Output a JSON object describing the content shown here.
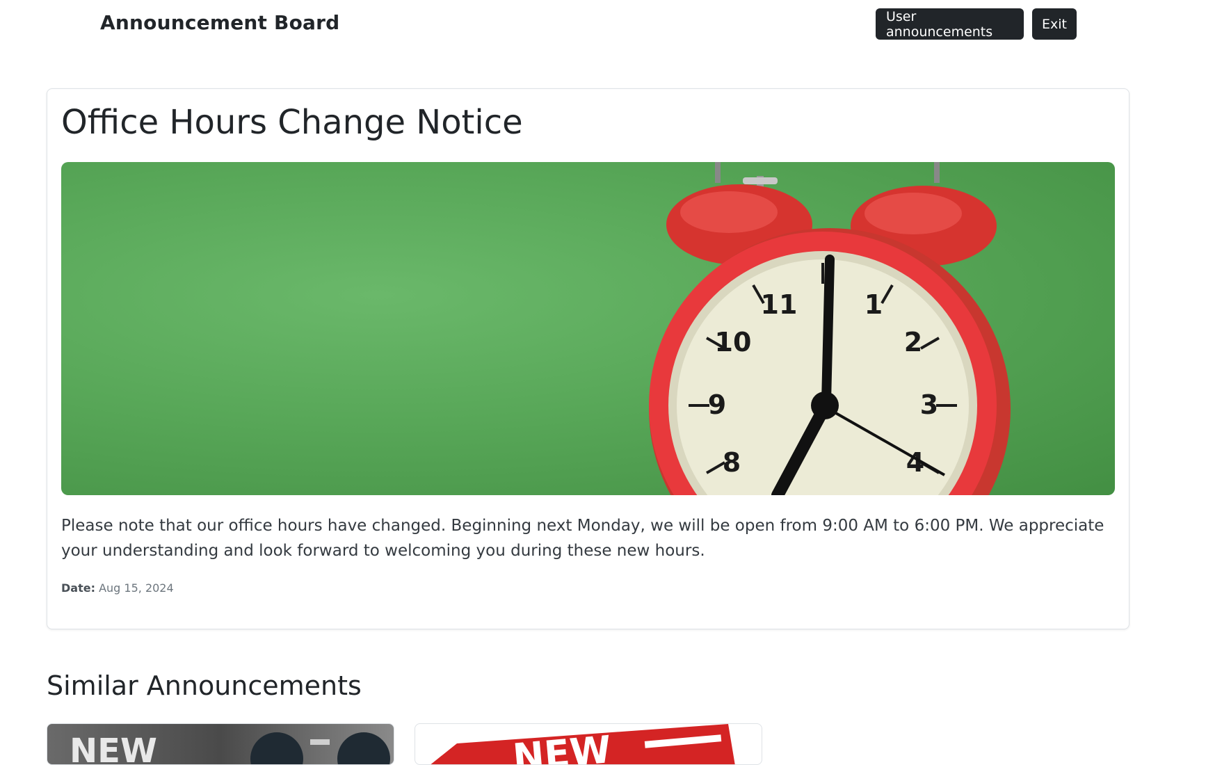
{
  "navbar": {
    "brand": "Announcement Board",
    "user_announcements_label": "User announcements",
    "exit_label": "Exit"
  },
  "announcement": {
    "title": "Office Hours Change Notice",
    "body": "Please note that our office hours have changed. Beginning next Monday, we will be open from 9:00 AM to 6:00 PM. We appreciate your understanding and look forward to welcoming you during these new hours.",
    "date_label": "Date:",
    "date_value": "Aug 15, 2024",
    "image_icon": "alarm-clock-image",
    "clock_numbers": [
      "1",
      "2",
      "3",
      "4",
      "8",
      "9",
      "10",
      "11"
    ]
  },
  "similar": {
    "title": "Similar Announcements",
    "thumb1_text": "NEW",
    "thumb2_text": "NEW"
  },
  "colors": {
    "dark": "#212529",
    "green_bg": "#58a758",
    "clock_red": "#e8393c",
    "clock_face": "#ecebd6"
  }
}
